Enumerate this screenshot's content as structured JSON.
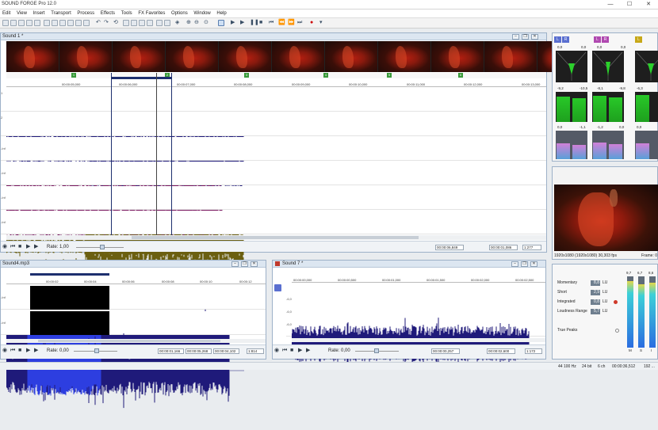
{
  "app": {
    "title": "SOUND FORGE Pro 12.0"
  },
  "window_controls": {
    "minimize": "—",
    "maximize": "☐",
    "close": "✕"
  },
  "menu": [
    "Edit",
    "View",
    "Insert",
    "Transport",
    "Process",
    "Effects",
    "Tools",
    "FX Favorites",
    "Options",
    "Window",
    "Help"
  ],
  "main_window": {
    "title": "Sound 1 *",
    "ruler_ticks": [
      "00:00:05,000",
      "00:00:06,000",
      "00:00:07,000",
      "00:00:08,000",
      "00:00:09,000",
      "00:00:10,000",
      "00:00:11,000",
      "00:00:12,000",
      "00:00:13,000"
    ],
    "markers": [
      "1",
      "2",
      "3",
      "4",
      "5",
      "6"
    ],
    "track_labels": [
      "1",
      "2",
      "-Inf",
      "-Inf",
      "-Inf",
      "-Inf"
    ],
    "rate_label": "Rate: 1,00",
    "pos1": "00:00:06,849",
    "pos2": "00:00:01,086",
    "ratio": "1:277"
  },
  "window2": {
    "title": "Sound4.mp3",
    "ruler_ticks": [
      "00:00:02",
      "00:00:04",
      "00:00:06",
      "00:00:08",
      "00:00:10",
      "00:00:12"
    ],
    "track_labels": [
      "-Inf",
      "-Inf"
    ],
    "rate_label": "Rate: 0,00",
    "pos1": "00:00:01,166",
    "pos2": "00:00:05,268",
    "pos3": "00:00:04,102",
    "ratio": "1:814"
  },
  "window3": {
    "title": "Sound 7 *",
    "ruler_ticks": [
      "00:00:00,000",
      "00:00:00,500",
      "00:00:01,000",
      "00:00:01,500",
      "00:00:02,000",
      "00:00:02,500"
    ],
    "track_labels": [
      "-6,0",
      "-6,0",
      "-6,0"
    ],
    "rate_label": "Rate: 0,00",
    "pos1": "00:00:00,257",
    "pos2": "00:00:02,600",
    "ratio": "1:172"
  },
  "meters": {
    "channel_buttons": [
      "L",
      "R",
      "L",
      "R",
      "L"
    ],
    "peak_values": [
      "0,0",
      "0,0",
      "0,0",
      "0,0",
      "0,0",
      "0,0"
    ],
    "level_values": [
      "-9,2",
      "-10,5",
      "-8,1",
      "-9,8",
      "-6,3",
      "-7,0"
    ],
    "rms_values": [
      "0,0",
      "-1,1",
      "-1,2",
      "0,0",
      "0,0",
      "-1,1"
    ]
  },
  "video": {
    "info": "1920x1080 (1920x1080) 30,303 fps",
    "frame_label": "Frame: 0"
  },
  "loudness": {
    "rows": [
      {
        "label": "Momentary",
        "value": "8,8",
        "unit": "LU"
      },
      {
        "label": "Short",
        "value": "2,9",
        "unit": "LU"
      },
      {
        "label": "Integrated",
        "value": "0,8",
        "unit": "LU"
      },
      {
        "label": "Loudness Range",
        "value": "5,7",
        "unit": "LU"
      }
    ],
    "true_peaks_label": "True Peaks",
    "meter_tops": [
      "9,7",
      "6,7",
      "8,6"
    ],
    "meter_bottoms": [
      "M",
      "S",
      "I"
    ]
  },
  "status": {
    "sample_rate": "44 100 Hz",
    "bit_depth": "24 bit",
    "channels": "6 ch",
    "length": "00:00:36,512",
    "free": "192 ..."
  },
  "colors": {
    "wave_blue": "#1f1a7a",
    "wave_magenta": "#7a1860",
    "wave_olive": "#6b5f10",
    "meter_green": "#28c828",
    "accent": "#5a7fb0"
  }
}
